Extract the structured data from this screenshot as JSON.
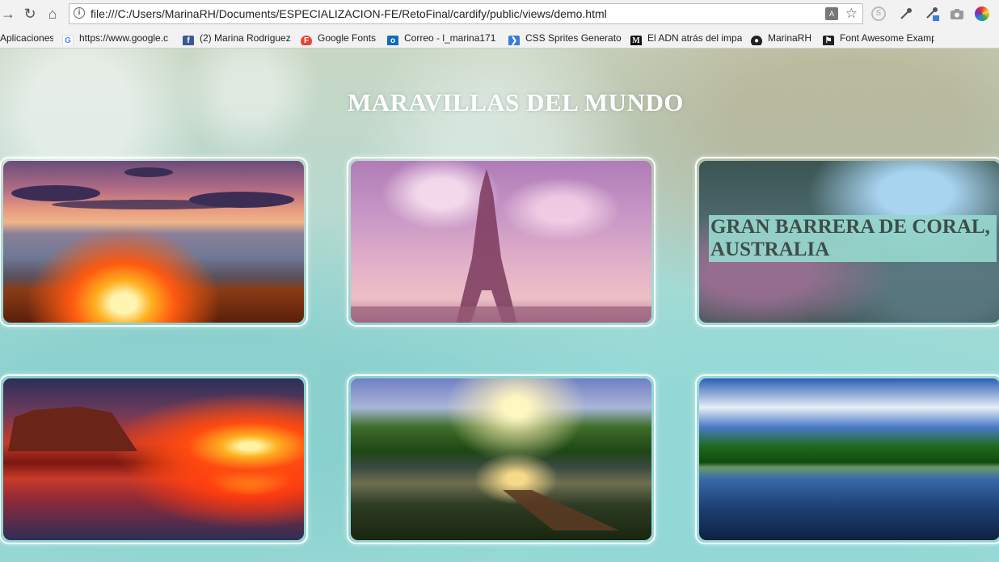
{
  "browser": {
    "url": "file:///C:/Users/MarinaRH/Documents/ESPECIALIZACION-FE/RetoFinal/cardify/public/views/demo.html",
    "bookmarks": [
      {
        "label": "Aplicaciones",
        "icon": "apps-grid-icon"
      },
      {
        "label": "https://www.google.c",
        "icon": "google-icon"
      },
      {
        "label": "(2) Marina Rodriguez",
        "icon": "facebook-icon"
      },
      {
        "label": "Google Fonts",
        "icon": "google-fonts-icon"
      },
      {
        "label": "Correo - l_marina171",
        "icon": "outlook-icon"
      },
      {
        "label": "CSS Sprites Generato",
        "icon": "css-sprites-icon"
      },
      {
        "label": "El ADN atrás del impa",
        "icon": "medium-icon"
      },
      {
        "label": "MarinaRH",
        "icon": "github-icon"
      },
      {
        "label": "Font Awesome Examp",
        "icon": "font-awesome-icon"
      }
    ]
  },
  "page": {
    "title": "MARAVILLAS DEL MUNDO",
    "cards": [
      {
        "image": "campfire-beach-sunset"
      },
      {
        "image": "eiffel-tower-pink-sky"
      },
      {
        "image": "great-barrier-reef",
        "label": "GRAN BARRERA DE CORAL, AUSTRALIA"
      },
      {
        "image": "red-sunset-mesa"
      },
      {
        "image": "lake-dock-sunset"
      },
      {
        "image": "forest-lake-reflection"
      }
    ]
  },
  "colors": {
    "title_text": "#ffffff",
    "card_border": "#ffffff",
    "label_background": "#96d7cd",
    "label_text": "#3d4d4a"
  }
}
